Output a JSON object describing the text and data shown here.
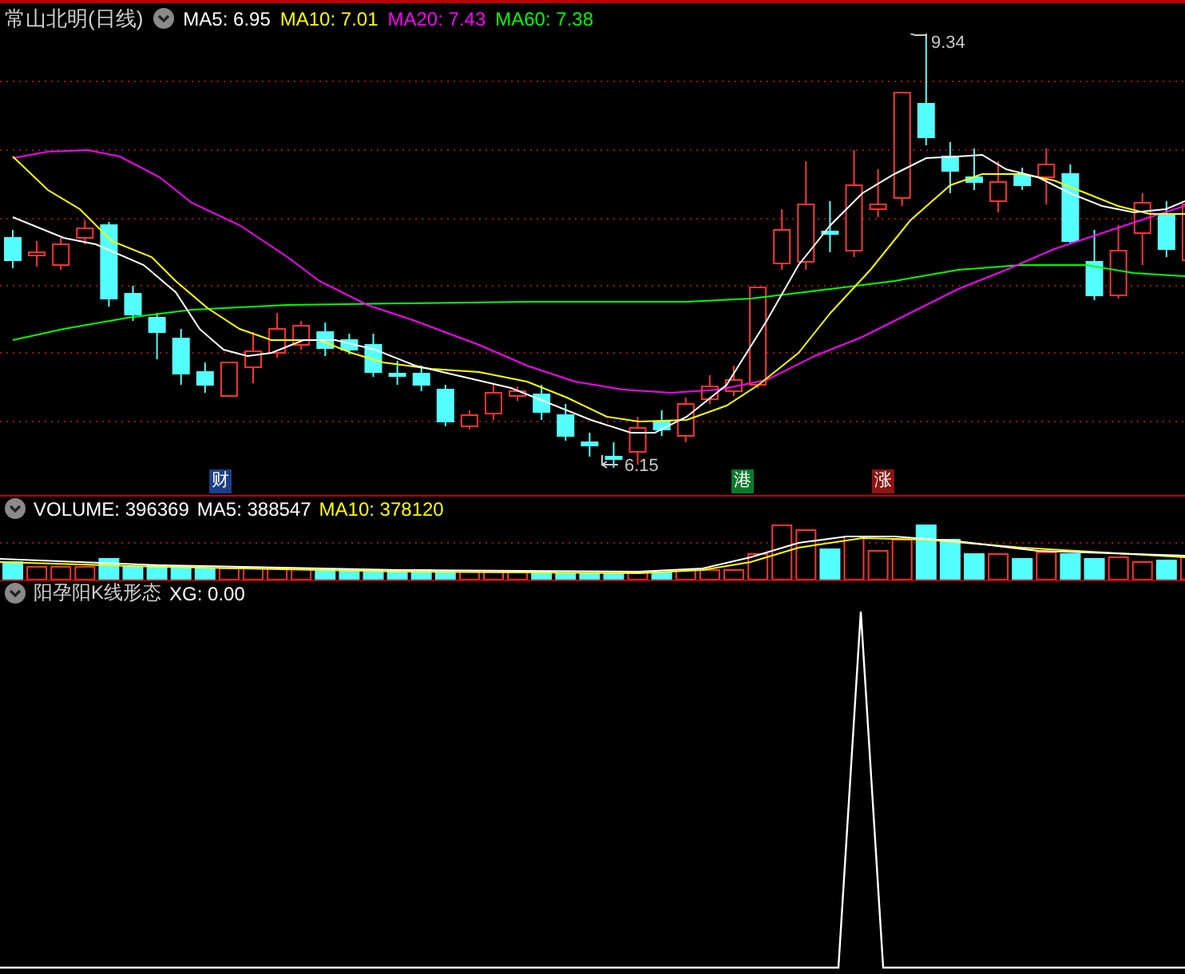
{
  "header": {
    "title": "常山北明(日线)",
    "indicators": [
      {
        "text": "MA5: 6.95",
        "color": "#ffffff"
      },
      {
        "text": "MA10: 7.01",
        "color": "#ffff00"
      },
      {
        "text": "MA20: 7.43",
        "color": "#ff00ff"
      },
      {
        "text": "MA60: 7.38",
        "color": "#00ff00"
      }
    ]
  },
  "price_marks": [
    {
      "kind": "high",
      "text": "9.34"
    },
    {
      "kind": "low",
      "text": "6.15"
    }
  ],
  "event_badges": [
    {
      "label": "财",
      "color": "#1c3f8c"
    },
    {
      "label": "港",
      "color": "#0b7a2a"
    },
    {
      "label": "涨",
      "color": "#8c1414"
    }
  ],
  "volume_header": {
    "indicators": [
      {
        "text": "VOLUME: 396369",
        "color": "#ffffff"
      },
      {
        "text": "MA5: 388547",
        "color": "#ffffff"
      },
      {
        "text": "MA10: 378120",
        "color": "#ffff00"
      }
    ]
  },
  "signal_header": {
    "title": "阳孕阳K线形态",
    "indicators": [
      {
        "text": "XG: 0.00",
        "color": "#ffffff"
      }
    ]
  }
}
